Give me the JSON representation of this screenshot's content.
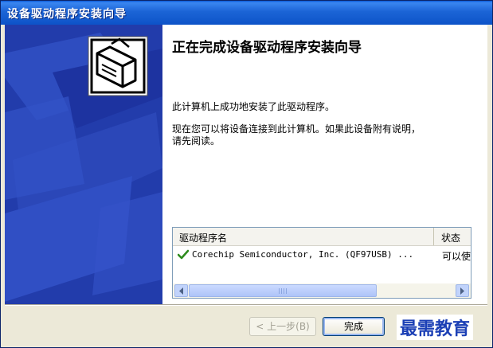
{
  "window": {
    "title": "设备驱动程序安装向导"
  },
  "wizard": {
    "heading": "正在完成设备驱动程序安装向导",
    "message1": "此计算机上成功地安装了此驱动程序。",
    "message2_line1": "现在您可以将设备连接到此计算机。如果此设备附有说明，",
    "message2_line2": "请先阅读。"
  },
  "driver_list": {
    "columns": [
      "驱动程序名",
      "状态"
    ],
    "rows": [
      {
        "name": "Corechip Semiconductor, Inc. (QF97USB) ...",
        "status": "可以使",
        "icon": "check-icon"
      }
    ],
    "scrollbar_grip": "III"
  },
  "buttons": {
    "back": "< 上一步(B)",
    "finish": "完成"
  },
  "watermark": "最需教育",
  "colors": {
    "title_bar": "#1b64d6",
    "left_panel": "#223cab",
    "check": "#2e8b1e",
    "watermark": "#1b3fb5"
  }
}
